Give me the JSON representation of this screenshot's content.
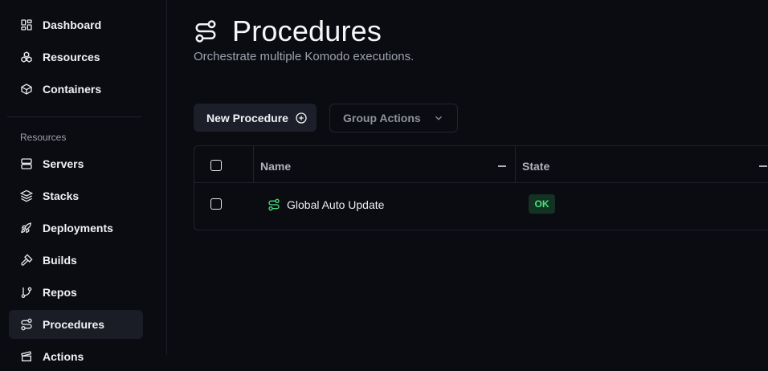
{
  "sidebar": {
    "top_items": [
      {
        "label": "Dashboard",
        "icon": "layout-dashboard-icon"
      },
      {
        "label": "Resources",
        "icon": "boxes-icon"
      },
      {
        "label": "Containers",
        "icon": "box-icon"
      }
    ],
    "section_label": "Resources",
    "items": [
      {
        "label": "Servers",
        "icon": "server-icon"
      },
      {
        "label": "Stacks",
        "icon": "layers-icon"
      },
      {
        "label": "Deployments",
        "icon": "rocket-icon"
      },
      {
        "label": "Builds",
        "icon": "hammer-icon"
      },
      {
        "label": "Repos",
        "icon": "git-branch-icon"
      },
      {
        "label": "Procedures",
        "icon": "route-icon",
        "active": true
      },
      {
        "label": "Actions",
        "icon": "clapperboard-icon"
      }
    ]
  },
  "header": {
    "title": "Procedures",
    "subtitle": "Orchestrate multiple Komodo executions."
  },
  "toolbar": {
    "new_label": "New Procedure",
    "group_label": "Group Actions"
  },
  "table": {
    "columns": [
      "Name",
      "State"
    ],
    "rows": [
      {
        "name": "Global Auto Update",
        "state": "OK"
      }
    ]
  },
  "colors": {
    "background": "#0b0c11",
    "accent_green": "#4ade80",
    "badge_bg": "#133322"
  }
}
